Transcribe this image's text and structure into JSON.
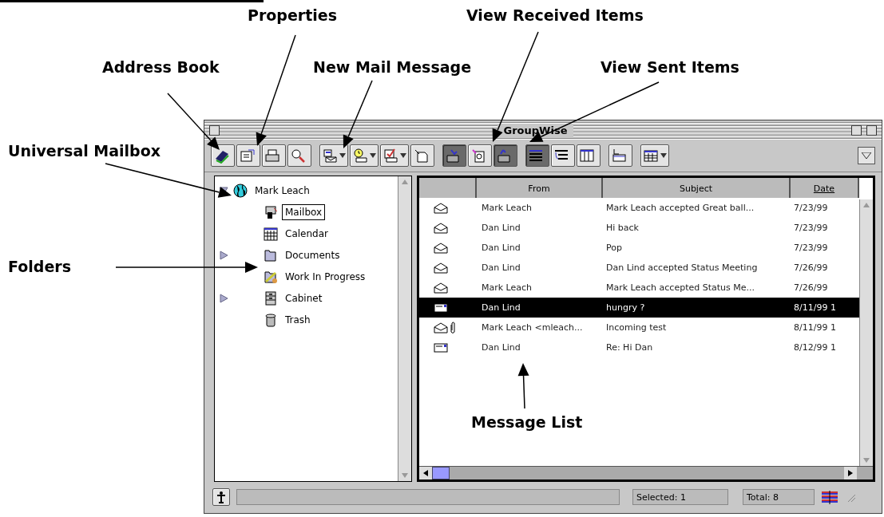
{
  "callouts": [
    {
      "label": "Properties"
    },
    {
      "label": "Address Book"
    },
    {
      "label": "New Mail Message"
    },
    {
      "label": "View Received Items"
    },
    {
      "label": "View Sent Items"
    },
    {
      "label": "Universal Mailbox"
    },
    {
      "label": "Folders"
    },
    {
      "label": "Message List"
    }
  ],
  "window": {
    "title": "GroupWise"
  },
  "toolbar": {
    "groups": [
      [
        {
          "kind": "plain",
          "pressed": false
        },
        {
          "kind": "plain",
          "pressed": false
        },
        {
          "kind": "plain",
          "pressed": false
        },
        {
          "kind": "plain",
          "pressed": false
        }
      ],
      [
        {
          "kind": "dropdown",
          "pressed": false
        },
        {
          "kind": "dropdown",
          "pressed": false
        },
        {
          "kind": "dropdown",
          "pressed": false
        },
        {
          "kind": "plain",
          "pressed": false
        }
      ],
      [
        {
          "kind": "plain",
          "pressed": true
        },
        {
          "kind": "plain",
          "pressed": false
        },
        {
          "kind": "plain",
          "pressed": true
        }
      ],
      [
        {
          "kind": "plain",
          "pressed": true
        },
        {
          "kind": "plain",
          "pressed": false
        },
        {
          "kind": "plain",
          "pressed": false
        }
      ],
      [
        {
          "kind": "plain",
          "pressed": false
        }
      ],
      [
        {
          "kind": "dropdown",
          "pressed": false
        }
      ]
    ]
  },
  "folders": {
    "label": "Mark Leach",
    "expanded": true,
    "children": [
      {
        "label": "Mailbox",
        "selected": true
      },
      {
        "label": "Calendar",
        "selected": false
      },
      {
        "label": "Documents",
        "selected": false,
        "expanded": false
      },
      {
        "label": "Work In Progress",
        "selected": false
      },
      {
        "label": "Cabinet",
        "selected": false,
        "expanded": false
      },
      {
        "label": "Trash",
        "selected": false
      }
    ]
  },
  "messages": {
    "columns": [
      {
        "label": "From",
        "sorted": false
      },
      {
        "label": "Subject",
        "sorted": false
      },
      {
        "label": "Date",
        "sorted": true
      }
    ],
    "rows": [
      {
        "kind": "opened",
        "attachment": false,
        "from": "Mark Leach",
        "subject": "Mark Leach accepted Great ball...",
        "date": "7/23/99",
        "selected": false
      },
      {
        "kind": "opened",
        "attachment": false,
        "from": "Dan Lind",
        "subject": "Hi back",
        "date": "7/23/99",
        "selected": false
      },
      {
        "kind": "opened",
        "attachment": false,
        "from": "Dan Lind",
        "subject": "Pop",
        "date": "7/23/99",
        "selected": false
      },
      {
        "kind": "opened",
        "attachment": false,
        "from": "Dan Lind",
        "subject": "Dan Lind accepted Status Meeting",
        "date": "7/26/99",
        "selected": false
      },
      {
        "kind": "opened",
        "attachment": false,
        "from": "Mark Leach",
        "subject": "Mark Leach accepted Status Me...",
        "date": "7/26/99",
        "selected": false
      },
      {
        "kind": "unopened",
        "attachment": false,
        "from": "Dan Lind",
        "subject": "hungry ?",
        "date": "8/11/99 1",
        "selected": true
      },
      {
        "kind": "opened",
        "attachment": true,
        "from": "Mark Leach <mleach...",
        "subject": "Incoming test",
        "date": "8/11/99 1",
        "selected": false
      },
      {
        "kind": "unopened",
        "attachment": false,
        "from": "Dan Lind",
        "subject": "Re: Hi Dan",
        "date": "8/12/99 1",
        "selected": false
      }
    ]
  },
  "status_bar": {
    "selected": "Selected: 1",
    "total": "Total: 8"
  }
}
